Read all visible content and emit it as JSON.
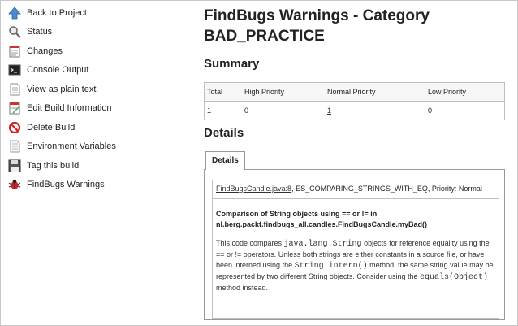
{
  "sidebar": {
    "items": [
      {
        "label": "Back to Project",
        "icon": "up-arrow-icon"
      },
      {
        "label": "Status",
        "icon": "magnifier-icon"
      },
      {
        "label": "Changes",
        "icon": "notepad-icon"
      },
      {
        "label": "Console Output",
        "icon": "terminal-icon"
      },
      {
        "label": "View as plain text",
        "icon": "document-icon"
      },
      {
        "label": "Edit Build Information",
        "icon": "edit-notepad-icon"
      },
      {
        "label": "Delete Build",
        "icon": "no-entry-icon"
      },
      {
        "label": "Environment Variables",
        "icon": "document-list-icon"
      },
      {
        "label": "Tag this build",
        "icon": "save-disk-icon"
      },
      {
        "label": "FindBugs Warnings",
        "icon": "bug-icon"
      }
    ]
  },
  "page": {
    "title": "FindBugs Warnings - Category BAD_PRACTICE",
    "summary_heading": "Summary",
    "details_heading": "Details"
  },
  "summary_table": {
    "headers": [
      "Total",
      "High Priority",
      "Normal Priority",
      "Low Priority"
    ],
    "values": [
      "1",
      "0",
      "1",
      "0"
    ]
  },
  "details": {
    "tab_label": "Details",
    "file_link": "FindBugsCandle.java:8",
    "bug_meta": ", ES_COMPARING_STRINGS_WITH_EQ, Priority: Normal",
    "bug_title": "Comparison of String objects using == or != in nl.berg.packt.findbugs_all.candles.FindBugsCandle.myBad()",
    "desc": {
      "p1": "This code compares ",
      "code1": "java.lang.String",
      "p2": " objects for reference equality using the == or != operators. Unless both strings are either constants in a source file, or have been interned using the ",
      "code2": "String.intern()",
      "p3": " method, the same string value may be represented by two different String objects. Consider using the ",
      "code3": "equals(Object)",
      "p4": " method instead."
    }
  },
  "colors": {
    "text": "#222222",
    "border": "#bfbfbf",
    "bug_red": "#cc2222",
    "no_entry_red": "#d42020"
  }
}
